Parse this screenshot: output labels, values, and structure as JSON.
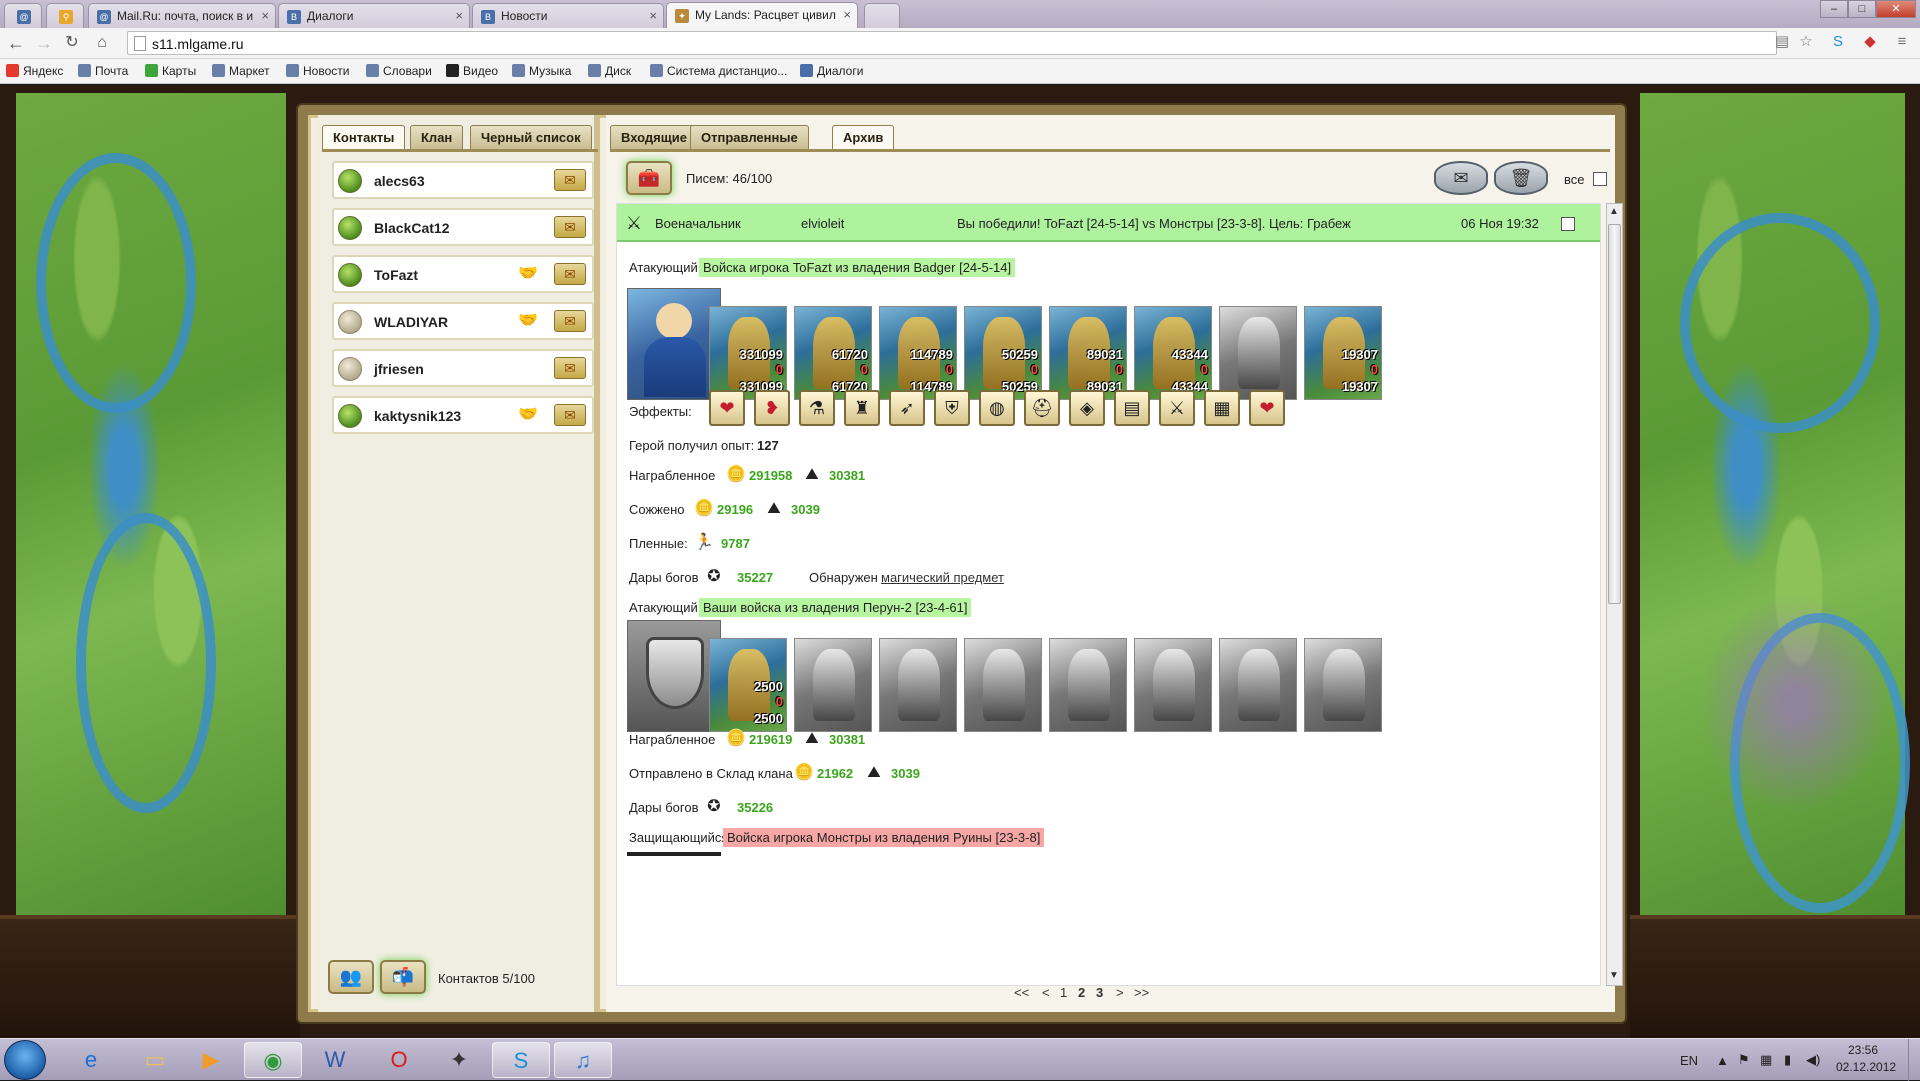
{
  "browser": {
    "tabs": [
      {
        "label": "",
        "icon": "mail-ru-icon"
      },
      {
        "label": "",
        "icon": "search-icon"
      },
      {
        "label": "Mail.Ru: почта, поиск в и",
        "icon": "mail-ru-icon"
      },
      {
        "label": "Диалоги",
        "icon": "vk-icon"
      },
      {
        "label": "Новости",
        "icon": "vk-icon"
      },
      {
        "label": "My Lands: Расцвет цивил",
        "icon": "game-icon"
      }
    ],
    "active_tab": 5,
    "url": "s11.mlgame.ru",
    "bookmarks": [
      "Яндекс",
      "Почта",
      "Карты",
      "Маркет",
      "Новости",
      "Словари",
      "Видео",
      "Музыка",
      "Диск",
      "Система дистанцио...",
      "Диалоги"
    ]
  },
  "contacts_panel": {
    "tabs": [
      "Контакты",
      "Клан",
      "Черный список"
    ],
    "active_tab": 0,
    "contacts": [
      {
        "name": "alecs63",
        "online": true,
        "trade": false
      },
      {
        "name": "BlackCat12",
        "online": true,
        "trade": false
      },
      {
        "name": "ToFazt",
        "online": true,
        "trade": true
      },
      {
        "name": "WLADIYAR",
        "online": false,
        "trade": true
      },
      {
        "name": "jfriesen",
        "online": false,
        "trade": false
      },
      {
        "name": "kaktysnik123",
        "online": true,
        "trade": true
      }
    ],
    "footer_count": "Контактов 5/100"
  },
  "mail_panel": {
    "tabs": [
      "Входящие",
      "Отправленные",
      "Архив"
    ],
    "active_tab": 2,
    "letters_count": "Писем: 46/100",
    "select_all_label": "все",
    "message": {
      "sender_type": "Военачальник",
      "sender": "elvioleit",
      "subject": "Вы победили! ToFazt [24-5-14] vs Монстры [23-3-8]. Цель: Грабеж",
      "date": "06 Ноя 19:32"
    },
    "attacker1": {
      "label": "Атакующий",
      "title": "Войска игрока ToFazt из владения Badger [24-5-14]",
      "units": [
        {
          "n1": "331099",
          "n0": "0",
          "n2": "331099"
        },
        {
          "n1": "61720",
          "n0": "0",
          "n2": "61720"
        },
        {
          "n1": "114789",
          "n0": "0",
          "n2": "114789"
        },
        {
          "n1": "50259",
          "n0": "0",
          "n2": "50259"
        },
        {
          "n1": "89031",
          "n0": "0",
          "n2": "89031"
        },
        {
          "n1": "43344",
          "n0": "0",
          "n2": "43344"
        },
        {
          "n1": "",
          "n0": "",
          "n2": ""
        },
        {
          "n1": "19307",
          "n0": "0",
          "n2": "19307"
        }
      ],
      "effects_label": "Эффекты:",
      "effects": [
        "heart-icon",
        "heart-leaf-icon",
        "potion-icon",
        "tower-icon",
        "arrows-icon",
        "shield-icon",
        "globe-icon",
        "helmet-icon",
        "crystal-icon",
        "book-icon",
        "sword-icon",
        "map-icon",
        "heart-icon"
      ],
      "exp_label": "Герой получил опыт:",
      "exp_value": "127",
      "looted_label": "Награбленное",
      "looted_gold": "291958",
      "looted_ore": "30381",
      "burned_label": "Сожжено",
      "burned_gold": "29196",
      "burned_ore": "3039",
      "captives_label": "Пленные:",
      "captives": "9787",
      "gifts_label": "Дары богов",
      "gifts": "35227",
      "found_label": "Обнаружен",
      "found_link": "магический предмет"
    },
    "attacker2": {
      "label": "Атакующий",
      "title": "Ваши войска из владения Перун-2 [23-4-61]",
      "units": [
        {
          "n1": "2500",
          "n0": "0",
          "n2": "2500"
        }
      ],
      "gray_units": 7,
      "looted_label": "Награбленное",
      "looted_gold": "219619",
      "looted_ore": "30381",
      "sent_label": "Отправлено в Склад клана",
      "sent_gold": "21962",
      "sent_ore": "3039",
      "gifts_label": "Дары богов",
      "gifts": "35226"
    },
    "defender": {
      "label": "Защищающийся",
      "title": "Войска игрока Монстры из владения Руины [23-3-8]"
    },
    "pager": {
      "first": "<<",
      "prev": "<",
      "pages": [
        "1",
        "2",
        "3"
      ],
      "current": "2",
      "next": ">",
      "last": ">>"
    }
  },
  "taskbar": {
    "lang": "EN",
    "time": "23:56",
    "date": "02.12.2012"
  }
}
